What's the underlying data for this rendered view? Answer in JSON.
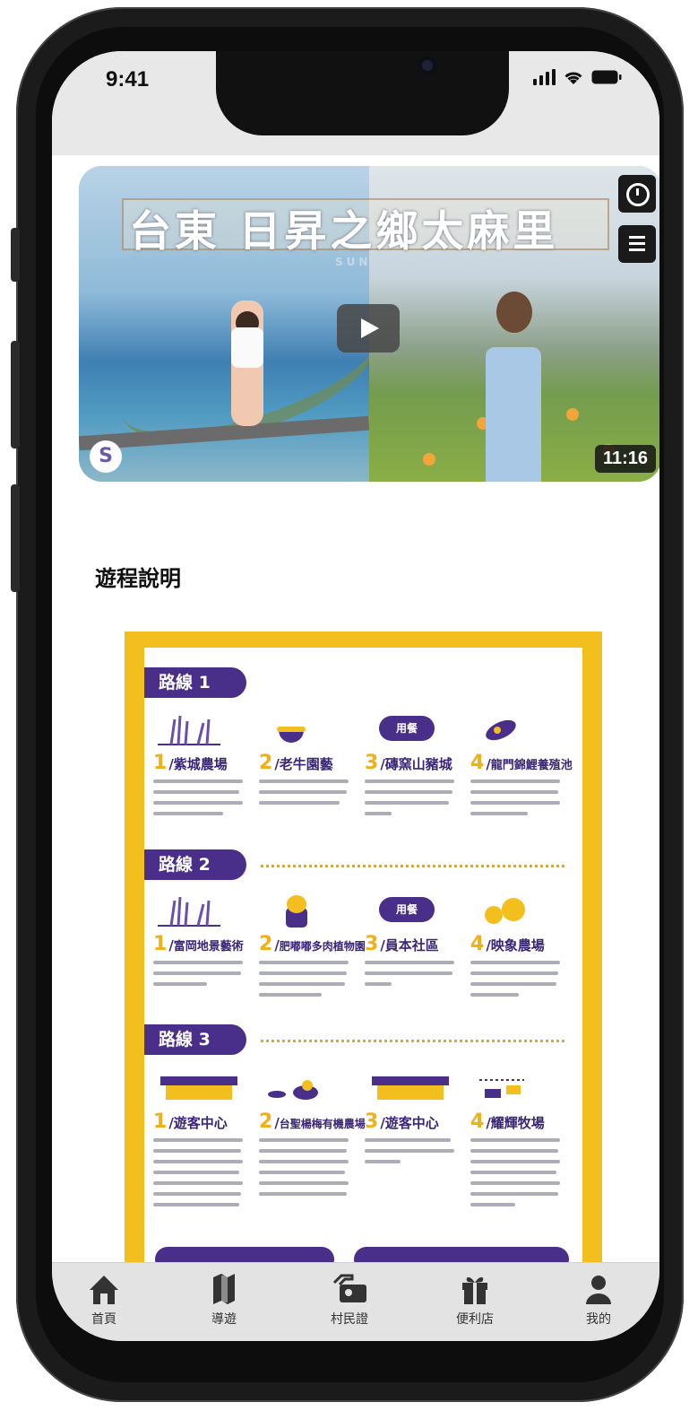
{
  "status_bar": {
    "time": "9:41"
  },
  "video": {
    "title": "台東 日昇之鄉太麻里",
    "subtitle": "SUNRISE HOMETOWN IN TAITUNG",
    "duration": "11:16",
    "channel_logo": "S"
  },
  "section": {
    "title": "遊程說明"
  },
  "poster": {
    "routes": [
      {
        "label": "路線 1",
        "stops": [
          {
            "num": "1",
            "name": "紫城農場"
          },
          {
            "num": "2",
            "name": "老牛園藝"
          },
          {
            "num": "3",
            "name": "磚窯山豬城",
            "badge": "用餐"
          },
          {
            "num": "4",
            "name": "龍門錦鯉養殖池"
          }
        ]
      },
      {
        "label": "路線 2",
        "stops": [
          {
            "num": "1",
            "name": "富岡地景藝術"
          },
          {
            "num": "2",
            "name": "肥嘟嘟多肉植物園"
          },
          {
            "num": "3",
            "name": "員本社區",
            "badge": "用餐"
          },
          {
            "num": "4",
            "name": "映象農場"
          }
        ]
      },
      {
        "label": "路線 3",
        "stops": [
          {
            "num": "1",
            "name": "遊客中心"
          },
          {
            "num": "2",
            "name": "台聖楊梅有機農場"
          },
          {
            "num": "3",
            "name": "遊客中心"
          },
          {
            "num": "4",
            "name": "耀輝牧場"
          }
        ]
      }
    ]
  },
  "tabs": [
    {
      "label": "首頁",
      "icon": "home-icon"
    },
    {
      "label": "導遊",
      "icon": "map-icon"
    },
    {
      "label": "村民證",
      "icon": "id-card-icon"
    },
    {
      "label": "便利店",
      "icon": "gift-icon"
    },
    {
      "label": "我的",
      "icon": "person-icon"
    }
  ],
  "colors": {
    "accent_purple": "#4a2f8a",
    "accent_yellow": "#f3bf1f"
  }
}
